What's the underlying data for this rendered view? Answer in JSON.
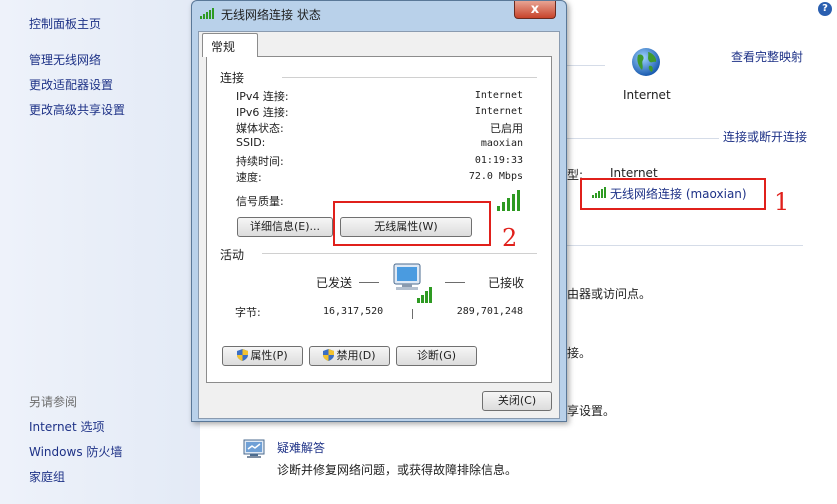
{
  "sidebar": {
    "home": "控制面板主页",
    "links": [
      "管理无线网络",
      "更改适配器设置",
      "更改高级共享设置"
    ],
    "see_also_title": "另请参阅",
    "see_also": [
      "Internet 选项",
      "Windows 防火墙",
      "家庭组"
    ]
  },
  "main": {
    "help_icon": "?",
    "view_full_map": "查看完整映射",
    "internet_label": "Internet",
    "connect_disconnect": "连接或断开连接",
    "access_type_label": "型:",
    "access_type_value": "Internet",
    "connection_link": "无线网络连接 (maoxian)",
    "frag1": "由器或访问点。",
    "frag2": "接。",
    "frag3": "享设置。",
    "troubleshoot_title": "疑难解答",
    "troubleshoot_desc": "诊断并修复网络问题，或获得故障排除信息。"
  },
  "dialog": {
    "title": "无线网络连接 状态",
    "tab": "常规",
    "connection_group": "连接",
    "rows": [
      {
        "label": "IPv4 连接:",
        "value": "Internet"
      },
      {
        "label": "IPv6 连接:",
        "value": "Internet"
      },
      {
        "label": "媒体状态:",
        "value": "已启用"
      },
      {
        "label": "SSID:",
        "value": "maoxian"
      },
      {
        "label": "持续时间:",
        "value": "01:19:33"
      },
      {
        "label": "速度:",
        "value": "72.0 Mbps"
      }
    ],
    "signal_label": "信号质量:",
    "details_button": "详细信息(E)...",
    "wireless_props_button": "无线属性(W)",
    "activity_group": "活动",
    "sent_label": "已发送",
    "received_label": "已接收",
    "bytes_label": "字节:",
    "bytes_sent": "16,317,520",
    "bytes_received": "289,701,248",
    "properties_button": "属性(P)",
    "disable_button": "禁用(D)",
    "diagnose_button": "诊断(G)",
    "close_button": "关闭(C)",
    "close_glyph": "x"
  },
  "annotations": {
    "one": "1",
    "two": "2"
  },
  "colors": {
    "link": "#1e3287",
    "annotation": "#e0201b",
    "titlebar": "#b9d1ea",
    "signal": "#2e9a22"
  }
}
